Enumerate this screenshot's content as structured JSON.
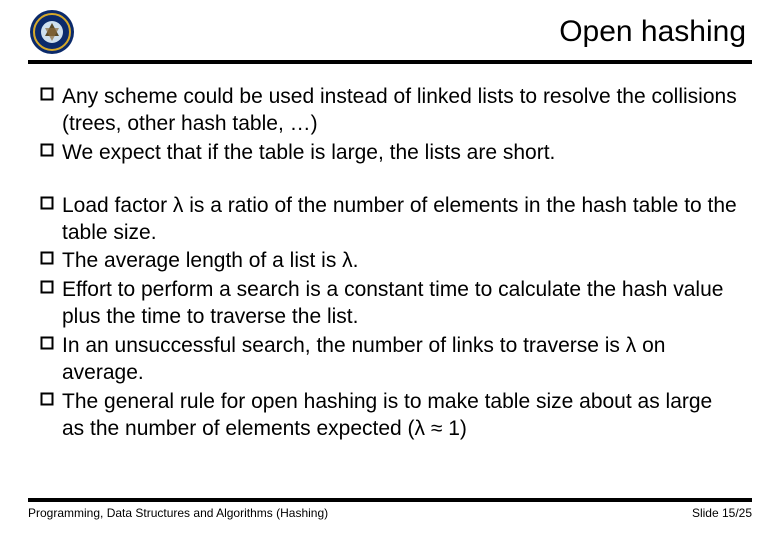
{
  "header": {
    "title": "Open hashing"
  },
  "bullets_group1": [
    "Any scheme could be used instead of linked lists to resolve the collisions (trees, other hash table, …)",
    "We expect that if the table is large, the lists are short."
  ],
  "bullets_group2": [
    "Load factor λ is a ratio of the number of elements in the hash table to the table size.",
    "The average length of a list is λ.",
    "Effort to perform a search is a constant time to calculate the hash value plus the time to traverse the list.",
    "In an unsuccessful search, the number of links to traverse is λ on average.",
    "The general rule for open hashing is to make table size about as large as the number of elements expected (λ ≈ 1)"
  ],
  "footer": {
    "left": "Programming, Data Structures and Algorithms (Hashing)",
    "right": "Slide 15/25"
  }
}
